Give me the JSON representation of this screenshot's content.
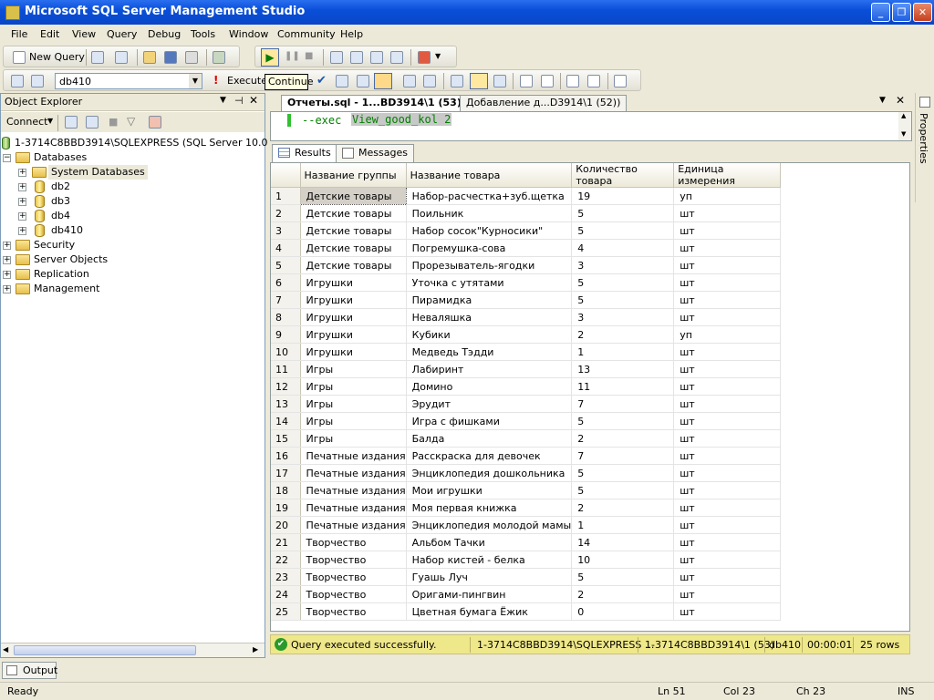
{
  "window": {
    "title": "Microsoft SQL Server Management Studio"
  },
  "menu": [
    "File",
    "Edit",
    "View",
    "Query",
    "Debug",
    "Tools",
    "Window",
    "Community",
    "Help"
  ],
  "toolbar": {
    "new_query": "New Query",
    "database": "db410",
    "execute": "Execute",
    "tooltip": "Continue"
  },
  "object_explorer": {
    "title": "Object Explorer",
    "connect": "Connect",
    "server": "1-3714C8BBD3914\\SQLEXPRESS (SQL Server 10.0.2531",
    "nodes": {
      "databases": "Databases",
      "system_databases": "System Databases",
      "db2": "db2",
      "db3": "db3",
      "db4": "db4",
      "db410": "db410",
      "security": "Security",
      "server_objects": "Server Objects",
      "replication": "Replication",
      "management": "Management"
    }
  },
  "doc_tabs": [
    "Отчеты.sql - 1...BD3914\\1 (53))",
    "Добавление д...D3914\\1 (52))"
  ],
  "editor": {
    "keyword": "--exec",
    "text": "View_good_kol 2"
  },
  "results_tabs": {
    "results": "Results",
    "messages": "Messages"
  },
  "grid": {
    "columns": [
      "Название группы",
      "Название товара",
      "Количество товара",
      "Единица измерения"
    ],
    "rows": [
      [
        "1",
        "Детские товары",
        "Набор-расчестка+зуб.щетка",
        "19",
        "уп"
      ],
      [
        "2",
        "Детские товары",
        "Поильник",
        "5",
        "шт"
      ],
      [
        "3",
        "Детские товары",
        "Набор сосок\"Курносики\"",
        "5",
        "шт"
      ],
      [
        "4",
        "Детские товары",
        "Погремушка-сова",
        "4",
        "шт"
      ],
      [
        "5",
        "Детские товары",
        "Прорезыватель-ягодки",
        "3",
        "шт"
      ],
      [
        "6",
        "Игрушки",
        "Уточка с утятами",
        "5",
        "шт"
      ],
      [
        "7",
        "Игрушки",
        "Пирамидка",
        "5",
        "шт"
      ],
      [
        "8",
        "Игрушки",
        "Неваляшка",
        "3",
        "шт"
      ],
      [
        "9",
        "Игрушки",
        "Кубики",
        "2",
        "уп"
      ],
      [
        "10",
        "Игрушки",
        "Медведь Тэдди",
        "1",
        "шт"
      ],
      [
        "11",
        "Игры",
        "Лабиринт",
        "13",
        "шт"
      ],
      [
        "12",
        "Игры",
        "Домино",
        "11",
        "шт"
      ],
      [
        "13",
        "Игры",
        "Эрудит",
        "7",
        "шт"
      ],
      [
        "14",
        "Игры",
        "Игра с фишками",
        "5",
        "шт"
      ],
      [
        "15",
        "Игры",
        "Балда",
        "2",
        "шт"
      ],
      [
        "16",
        "Печатные издания",
        "Расскраска для девочек",
        "7",
        "шт"
      ],
      [
        "17",
        "Печатные издания",
        "Энциклопедия дошкольника",
        "5",
        "шт"
      ],
      [
        "18",
        "Печатные издания",
        "Мои игрушки",
        "5",
        "шт"
      ],
      [
        "19",
        "Печатные издания",
        "Моя первая книжка",
        "2",
        "шт"
      ],
      [
        "20",
        "Печатные издания",
        "Энциклопедия молодой мамы",
        "1",
        "шт"
      ],
      [
        "21",
        "Творчество",
        "Альбом Тачки",
        "14",
        "шт"
      ],
      [
        "22",
        "Творчество",
        "Набор кистей - белка",
        "10",
        "шт"
      ],
      [
        "23",
        "Творчество",
        "Гуашь Луч",
        "5",
        "шт"
      ],
      [
        "24",
        "Творчество",
        "Оригами-пингвин",
        "2",
        "шт"
      ],
      [
        "25",
        "Творчество",
        "Цветная бумага Ёжик",
        "0",
        "шт"
      ]
    ]
  },
  "query_status": {
    "message": "Query executed successfully.",
    "server": "1-3714C8BBD3914\\SQLEXPRESS ...",
    "login": "1-3714C8BBD3914\\1 (53)",
    "database": "db410",
    "elapsed": "00:00:01",
    "rows": "25 rows"
  },
  "properties_label": "Properties",
  "output_tab": "Output",
  "status_bar": {
    "ready": "Ready",
    "ln": "Ln 51",
    "col": "Col 23",
    "ch": "Ch 23",
    "ins": "INS"
  },
  "colors": {
    "titlebar": "#0a4fd8",
    "status_yellow": "#efe88a",
    "selected_cell": "#d4d0c8"
  }
}
